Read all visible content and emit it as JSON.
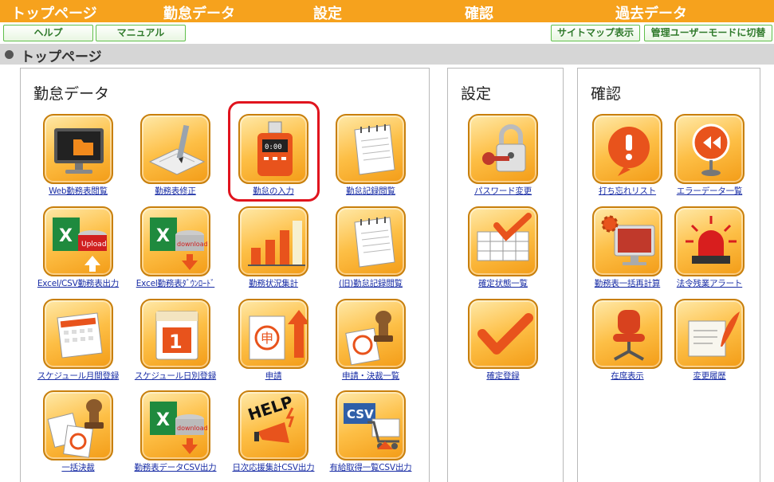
{
  "top_menu": [
    {
      "label": "トップページ"
    },
    {
      "label": "勤怠データ"
    },
    {
      "label": "設定"
    },
    {
      "label": "確認"
    },
    {
      "label": "過去データ"
    }
  ],
  "sub_buttons": {
    "help": "ヘルプ",
    "manual": "マニュアル",
    "sitemap": "サイトマップ表示",
    "admin_mode": "管理ユーザーモードに切替"
  },
  "breadcrumb": "トップページ",
  "sections": {
    "kintai": {
      "title": "勤怠データ",
      "items": [
        {
          "label": "Web勤務表閲覧",
          "icon": "monitor-folder-icon"
        },
        {
          "label": "勤務表修正",
          "icon": "pen-form-icon"
        },
        {
          "label": "勤怠の入力",
          "icon": "time-recorder-icon"
        },
        {
          "label": "勤怠記録閲覧",
          "icon": "notepad-icon"
        },
        {
          "label": "Excel/CSV勤務表出力",
          "icon": "excel-upload-icon"
        },
        {
          "label": "Excel勤務表ﾀﾞｳﾝﾛｰﾄﾞ",
          "icon": "excel-download-icon"
        },
        {
          "label": "勤務状況集計",
          "icon": "bar-chart-icon"
        },
        {
          "label": "(旧)勤怠記録閲覧",
          "icon": "notepad-icon"
        },
        {
          "label": "スケジュール月間登録",
          "icon": "calendar-icon"
        },
        {
          "label": "スケジュール日別登録",
          "icon": "daily-calendar-icon"
        },
        {
          "label": "申請",
          "icon": "stamp-apply-icon"
        },
        {
          "label": "申請・決裁一覧",
          "icon": "approval-stamp-icon"
        },
        {
          "label": "一括決裁",
          "icon": "bulk-stamp-icon"
        },
        {
          "label": "勤務表データCSV出力",
          "icon": "excel-download-icon"
        },
        {
          "label": "日次応援集計CSV出力",
          "icon": "help-megaphone-icon"
        },
        {
          "label": "有給取得一覧CSV出力",
          "icon": "csv-cart-icon"
        }
      ]
    },
    "settings": {
      "title": "設定",
      "items": [
        {
          "label": "パスワード変更",
          "icon": "padlock-key-icon"
        },
        {
          "label": "確定状態一覧",
          "icon": "grid-check-icon"
        },
        {
          "label": "確定登録",
          "icon": "checkmark-icon"
        }
      ]
    },
    "confirm": {
      "title": "確認",
      "items": [
        {
          "label": "打ち忘れリスト",
          "icon": "exclamation-icon"
        },
        {
          "label": "エラーデータ一覧",
          "icon": "error-sign-icon"
        },
        {
          "label": "勤務表一括再計算",
          "icon": "monitor-gear-icon"
        },
        {
          "label": "法令残業アラート",
          "icon": "siren-icon"
        },
        {
          "label": "在席表示",
          "icon": "office-chair-icon"
        },
        {
          "label": "変更履歴",
          "icon": "quill-scroll-icon"
        }
      ]
    }
  },
  "colors": {
    "menu_bg": "#f6a21d",
    "tile_orange": "#f39c17",
    "link_blue": "#1a2ea6",
    "highlight_red": "#e0141e",
    "button_green": "#5fbf4a"
  }
}
